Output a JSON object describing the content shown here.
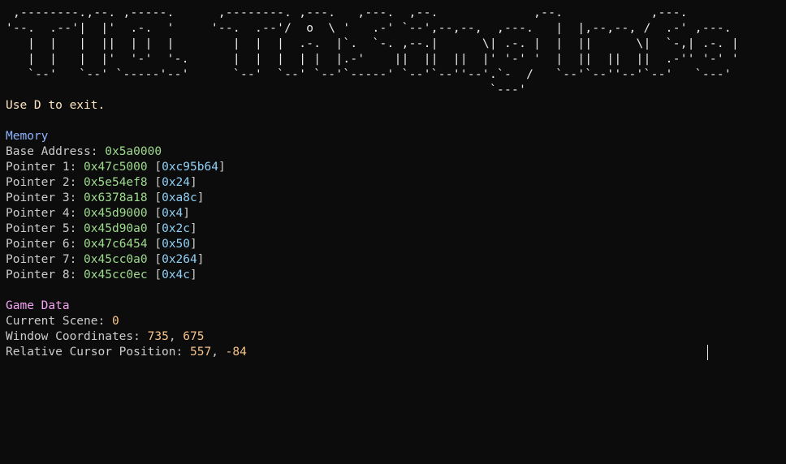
{
  "banner_lines": [
    " ,--------.,--. ,-----.      ,--------. ,---.   ,---.  ,--.             ,--.            ,---.",
    "'--.  .--'|  |'  .-.  '     '--.  .--'/  o  \\ '   .-' `--',--,--,  ,---.   |  |,--,--, /  .-' ,---.",
    "   |  |   |  ||  | |  |        |  |  |  .-.  |`.  `-. ,--.|      \\| .-. |  |  ||      \\|  `-,| .-. |",
    "   |  |   |  |'  '-'  '-.      |  |  |  | |  |.-'    ||  ||  ||  |' '-' '  |  ||  ||  ||  .-'' '-' '",
    "   `--'   `--' `-----'--'      `--'  `--' `--'`-----' `--'`--''--'.`-  /   `--'`--''--'`--'   `---'",
    "                                                                  `---'"
  ],
  "exit_message": "Use D to exit.",
  "memory": {
    "heading": "Memory",
    "base_label": "Base Address:",
    "base_value": "0x5a0000",
    "pointers": [
      {
        "label": "Pointer 1:",
        "address": "0x47c5000",
        "value": "0xc95b64"
      },
      {
        "label": "Pointer 2:",
        "address": "0x5e54ef8",
        "value": "0x24"
      },
      {
        "label": "Pointer 3:",
        "address": "0x6378a18",
        "value": "0xa8c"
      },
      {
        "label": "Pointer 4:",
        "address": "0x45d9000",
        "value": "0x4"
      },
      {
        "label": "Pointer 5:",
        "address": "0x45d90a0",
        "value": "0x2c"
      },
      {
        "label": "Pointer 6:",
        "address": "0x47c6454",
        "value": "0x50"
      },
      {
        "label": "Pointer 7:",
        "address": "0x45cc0a0",
        "value": "0x264"
      },
      {
        "label": "Pointer 8:",
        "address": "0x45cc0ec",
        "value": "0x4c"
      }
    ]
  },
  "game_data": {
    "heading": "Game Data",
    "scene_label": "Current Scene:",
    "scene_value": "0",
    "window_label": "Window Coordinates:",
    "window_x": "735",
    "window_y": "675",
    "cursor_label": "Relative Cursor Position:",
    "cursor_x": "557",
    "cursor_y": "-84"
  }
}
